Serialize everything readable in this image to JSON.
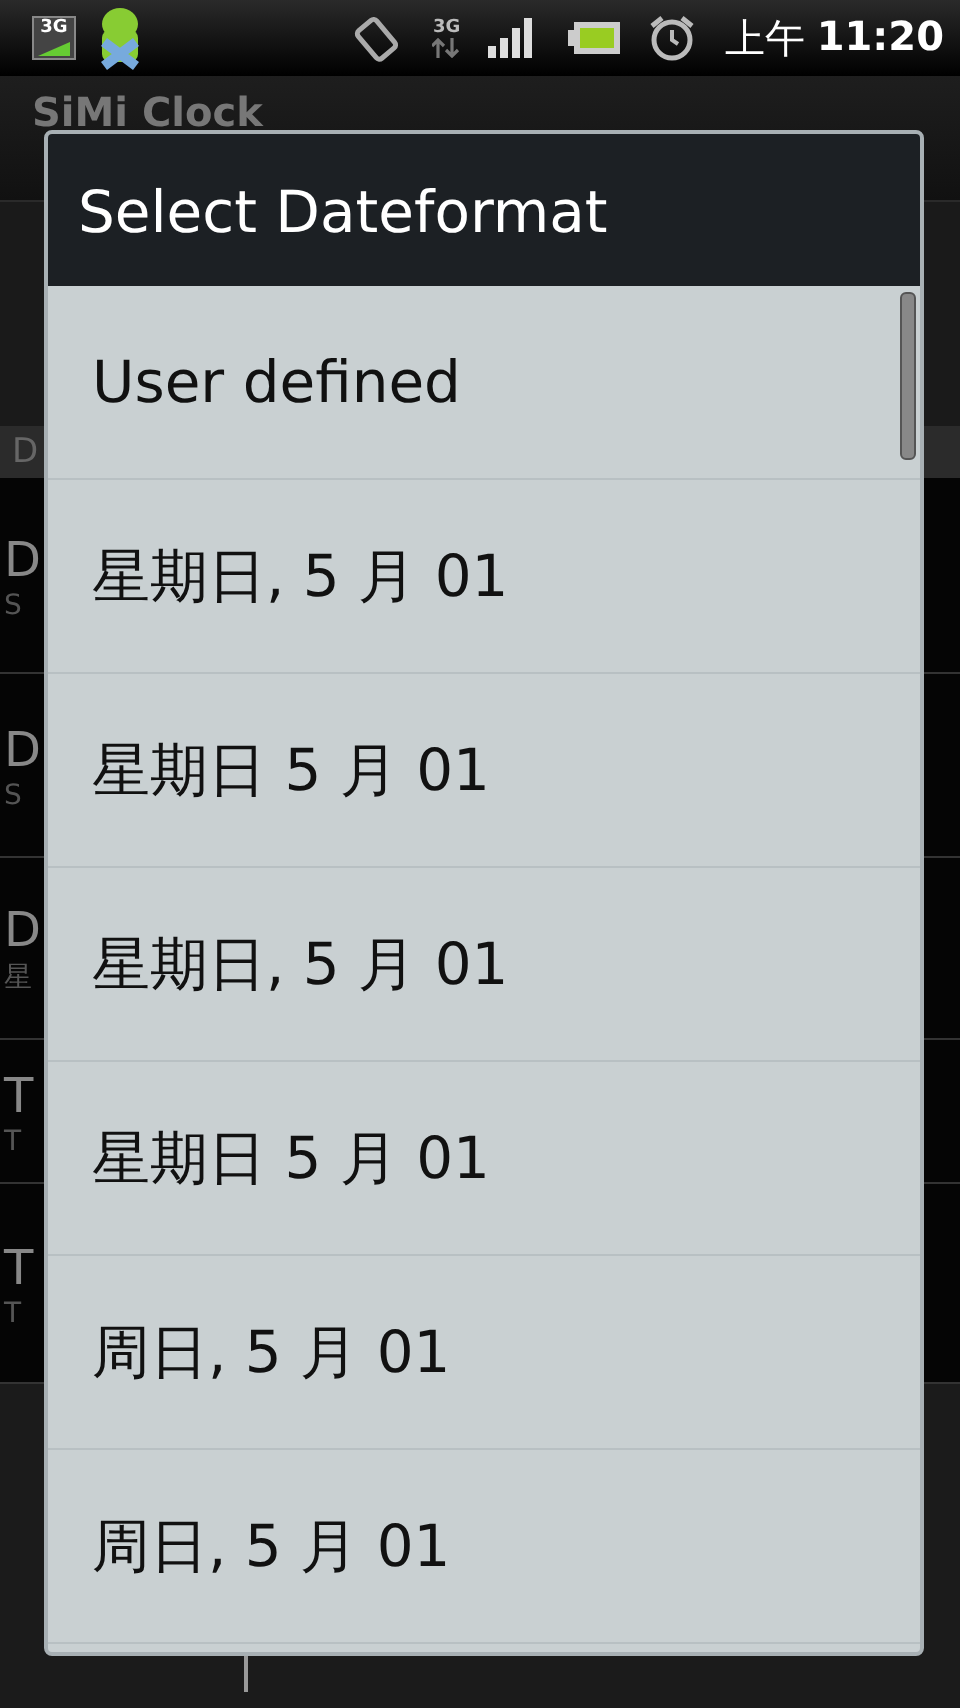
{
  "status_bar": {
    "network_badge": "3G",
    "data_type": "3G",
    "time_period": "上午",
    "time": "11:20"
  },
  "app": {
    "title": "SiMi Clock",
    "section_header": "D",
    "rows": [
      {
        "title": "D",
        "subtitle": "S"
      },
      {
        "title": "D",
        "subtitle": "S"
      },
      {
        "title": "D",
        "subtitle": "星"
      },
      {
        "title": "T",
        "subtitle": "T"
      },
      {
        "title": "T",
        "subtitle": "T"
      }
    ]
  },
  "dialog": {
    "title": "Select Dateformat",
    "options": [
      "User defined",
      "星期日, 5 月 01",
      "星期日 5 月 01",
      "星期日, 5 月 01",
      "星期日 5 月 01",
      "周日, 5 月 01",
      "周日, 5 月 01"
    ]
  }
}
